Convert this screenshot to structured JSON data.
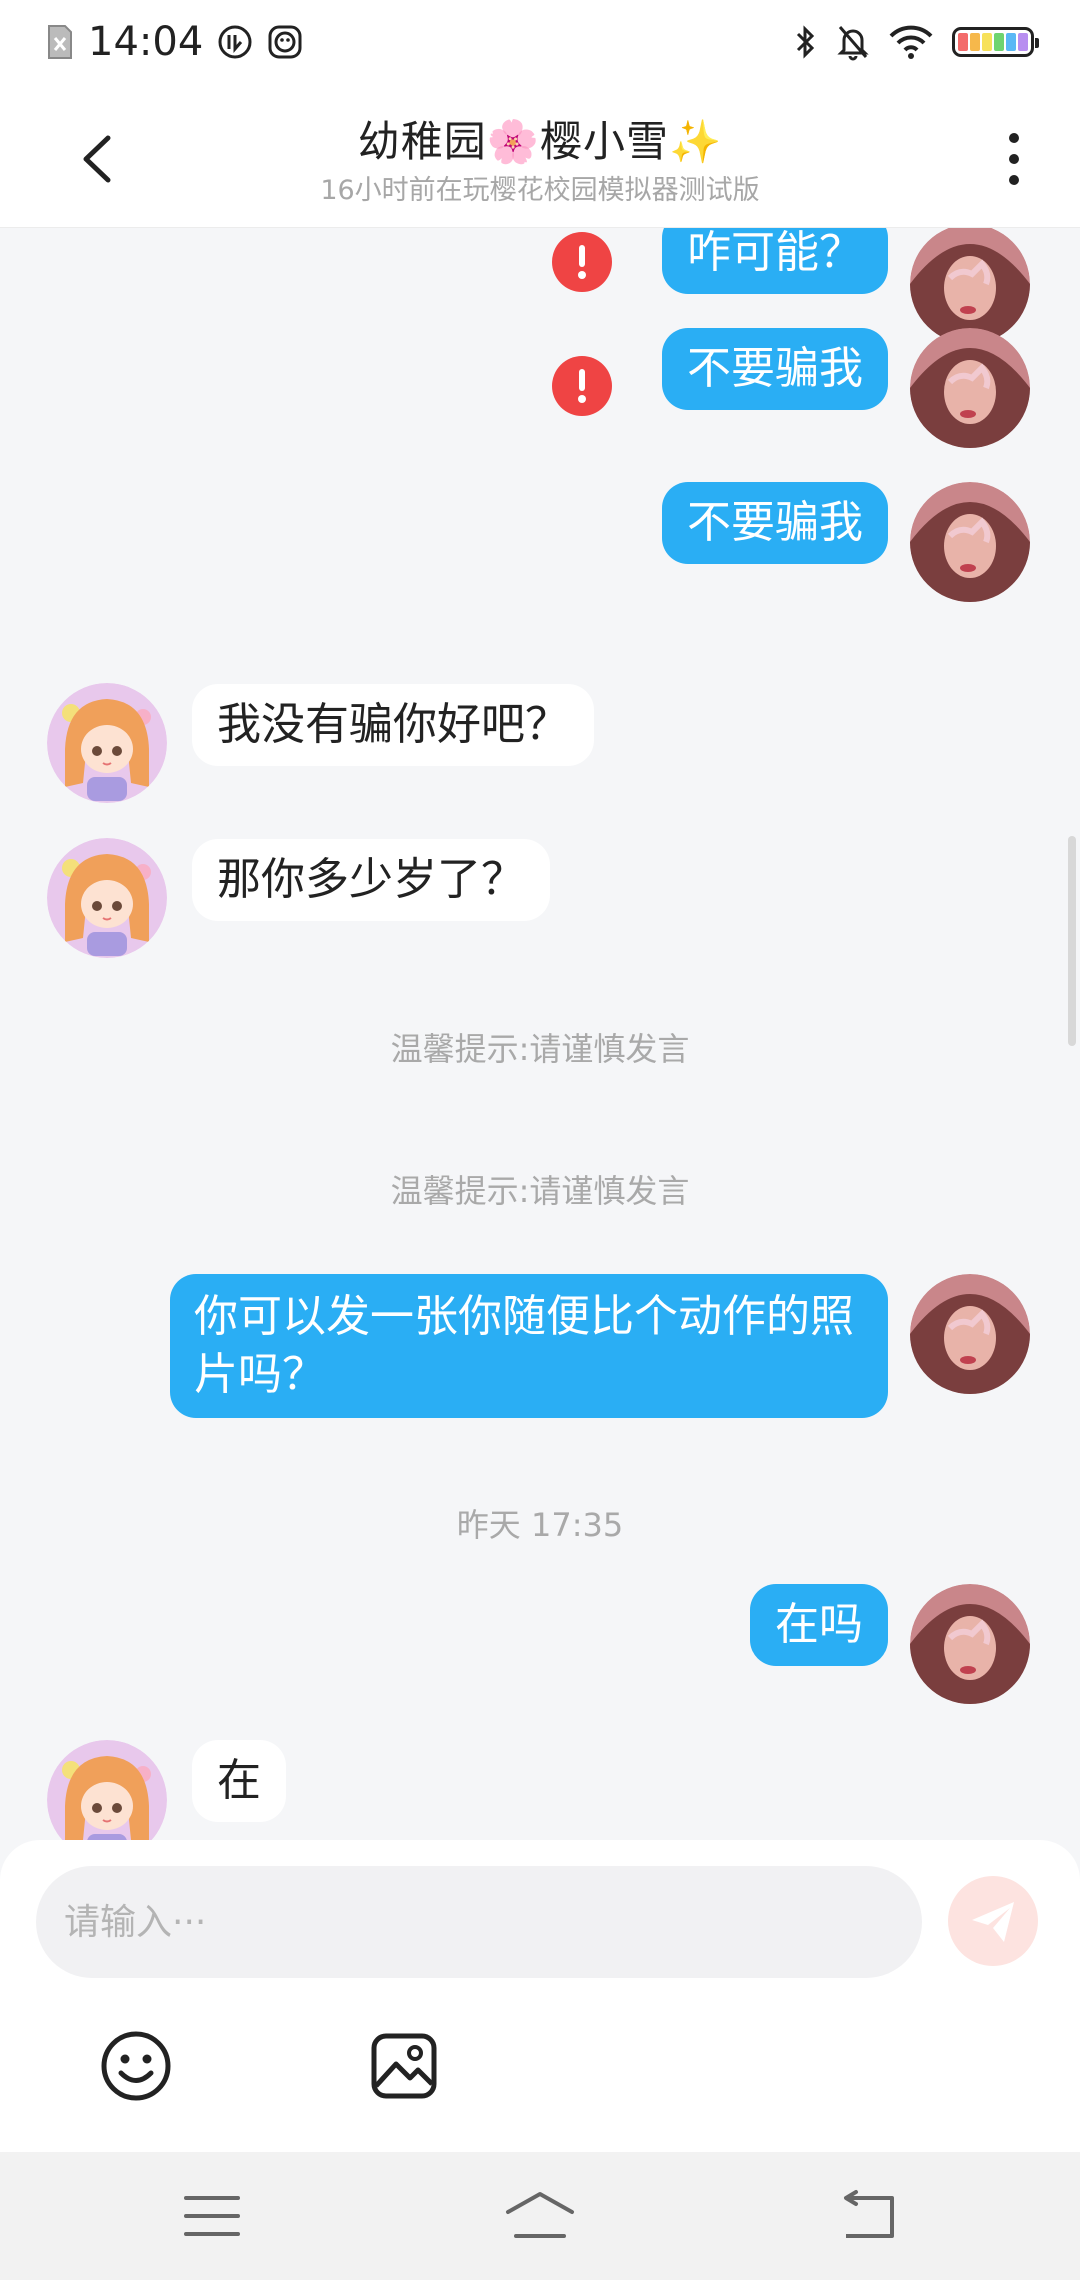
{
  "status_bar": {
    "time": "14:04",
    "left_icons": [
      "sim-off-icon",
      "vpn-icon",
      "shield-face-icon"
    ],
    "right_icons": [
      "bluetooth-icon",
      "mute-bell-icon",
      "wifi-icon",
      "battery-icon"
    ],
    "battery_colors": [
      "#f36b6b",
      "#f6b84b",
      "#f7e15a",
      "#6fd46f",
      "#5ab8f5",
      "#b88ef0"
    ]
  },
  "header": {
    "back_icon": "chevron-left-icon",
    "title": "幼稚园🌸樱小雪✨",
    "subtitle": "16小时前在玩樱花校园模拟器测试版",
    "more_icon": "more-vertical-icon"
  },
  "messages": [
    {
      "sender": "me",
      "text": "咋可能？",
      "failed": true
    },
    {
      "sender": "me",
      "text": "不要骗我",
      "failed": true
    },
    {
      "sender": "me",
      "text": "不要骗我",
      "failed": false
    },
    {
      "sender": "them",
      "text": "我没有骗你好吧？"
    },
    {
      "sender": "them",
      "text": "那你多少岁了？"
    },
    {
      "type": "notice",
      "text": "温馨提示:请谨慎发言"
    },
    {
      "type": "notice",
      "text": "温馨提示:请谨慎发言"
    },
    {
      "sender": "me",
      "text": "你可以发一张你随便比个动作的照片吗？"
    },
    {
      "type": "timestamp",
      "text": "昨天 17:35"
    },
    {
      "sender": "me",
      "text": "在吗"
    },
    {
      "sender": "them",
      "text": "在"
    }
  ],
  "input": {
    "placeholder": "请输入···",
    "value": "",
    "send_icon": "paper-plane-icon"
  },
  "toolbar": {
    "emoji_icon": "smiley-icon",
    "image_icon": "image-icon"
  },
  "nav_bar": {
    "icons": [
      "menu-icon",
      "home-icon",
      "back-icon"
    ]
  },
  "colors": {
    "my_bubble": "#2aaef4",
    "their_bubble": "#ffffff",
    "error": "#ef4444",
    "background": "#f5f6f8",
    "send_button": "#fde3e0"
  }
}
